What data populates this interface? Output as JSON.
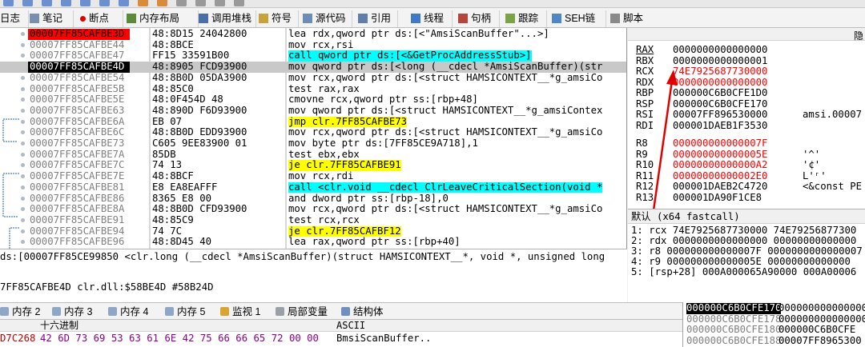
{
  "colors": {
    "highlight_yellow": "#ffff00",
    "highlight_cyan": "#00ffff",
    "breakpoint_red": "#ff0000",
    "rip_black": "#000000",
    "changed_register_red": "#ff0000",
    "arrow_red": "#e00000",
    "jump_line_blue": "#1f5fbf"
  },
  "tabs": [
    {
      "label": "日志",
      "icon": "log-icon"
    },
    {
      "label": "笔记",
      "icon": "notes-icon"
    },
    {
      "label": "断点",
      "icon": "breakpoint-icon"
    },
    {
      "label": "内存布局",
      "icon": "memory-map-icon"
    },
    {
      "label": "调用堆栈",
      "icon": "callstack-icon"
    },
    {
      "label": "符号",
      "icon": "symbols-icon"
    },
    {
      "label": "源代码",
      "icon": "source-icon"
    },
    {
      "label": "引用",
      "icon": "references-icon"
    },
    {
      "label": "线程",
      "icon": "threads-icon"
    },
    {
      "label": "句柄",
      "icon": "handles-icon"
    },
    {
      "label": "跟踪",
      "icon": "trace-icon"
    },
    {
      "label": "SEH链",
      "icon": "seh-icon"
    },
    {
      "label": "脚本",
      "icon": "script-icon"
    }
  ],
  "disasm": [
    {
      "addr": "00007FF85CAFBE3D",
      "bytes": "48:8D15 24042800",
      "instr": "lea rdx,qword ptr ds:[<\"AmsiScanBuffer\"...>]",
      "mark": "bp"
    },
    {
      "addr": "00007FF85CAFBE44",
      "bytes": "48:8BCE",
      "instr": "mov rcx,rsi"
    },
    {
      "addr": "00007FF85CAFBE47",
      "bytes": "FF15 33591B00",
      "instr": "call qword ptr ds:[<&GetProcAddressStub>]",
      "hl": "call"
    },
    {
      "addr": "00007FF85CAFBE4D",
      "bytes": "48:8905 FCD93900",
      "instr": "mov qword ptr ds:[<long (__cdecl *AmsiScanBuffer)(str",
      "mark": "rip"
    },
    {
      "addr": "00007FF85CAFBE54",
      "bytes": "48:8B0D 05DA3900",
      "instr": "mov rcx,qword ptr ds:[<struct HAMSICONTEXT__*g_amsiCo"
    },
    {
      "addr": "00007FF85CAFBE5B",
      "bytes": "48:85C0",
      "instr": "test rax,rax"
    },
    {
      "addr": "00007FF85CAFBE5E",
      "bytes": "48:0F454D 48",
      "instr": "cmovne rcx,qword ptr ss:[rbp+48]"
    },
    {
      "addr": "00007FF85CAFBE63",
      "bytes": "48:890D F6D93900",
      "instr": "mov qword ptr ds:[<struct HAMSICONTEXT__*g_amsiContex"
    },
    {
      "addr": "00007FF85CAFBE6A",
      "bytes": "EB 07",
      "instr": "jmp clr.7FF85CAFBE73",
      "hl": "jmp"
    },
    {
      "addr": "00007FF85CAFBE6C",
      "bytes": "48:8B0D EDD93900",
      "instr": "mov rcx,qword ptr ds:[<struct HAMSICONTEXT__*g_amsiCo"
    },
    {
      "addr": "00007FF85CAFBE73",
      "bytes": "C605 9EE83900 01",
      "instr": "mov byte ptr ds:[7FF85CE9A718],1"
    },
    {
      "addr": "00007FF85CAFBE7A",
      "bytes": "85DB",
      "instr": "test ebx,ebx"
    },
    {
      "addr": "00007FF85CAFBE7C",
      "bytes": "74 13",
      "instr": "je clr.7FF85CAFBE91",
      "hl": "jmp"
    },
    {
      "addr": "00007FF85CAFBE7E",
      "bytes": "48:8BCF",
      "instr": "mov rcx,rdi"
    },
    {
      "addr": "00007FF85CAFBE81",
      "bytes": "E8 EA8EAFFF",
      "instr": "call <clr.void __cdecl ClrLeaveCriticalSection(void *",
      "hl": "call"
    },
    {
      "addr": "00007FF85CAFBE86",
      "bytes": "8365 E8 00",
      "instr": "and dword ptr ss:[rbp-18],0"
    },
    {
      "addr": "00007FF85CAFBE8A",
      "bytes": "48:8B0D CFD93900",
      "instr": "mov rcx,qword ptr ds:[<struct HAMSICONTEXT__*g_amsiCo"
    },
    {
      "addr": "00007FF85CAFBE91",
      "bytes": "48:85C9",
      "instr": "test rcx,rcx"
    },
    {
      "addr": "00007FF85CAFBE94",
      "bytes": "74 7C",
      "instr": "je clr.7FF85CAFBF12",
      "hl": "jmp"
    },
    {
      "addr": "00007FF85CAFBE96",
      "bytes": "48:8D45 40",
      "instr": "lea rax,qword ptr ss:[rbp+40]"
    }
  ],
  "info": {
    "line1": "ds:[00007FF85CE99850 <clr.long (__cdecl *AmsiScanBuffer)(struct HAMSICONTEXT__*, void *, unsigned long",
    "line2": "7FF85CAFBE4D clr.dll:$58BE4D #58B24D"
  },
  "registers_header": "隐",
  "registers": [
    {
      "name": "RAX",
      "value": "0000000000000000",
      "comment": "",
      "changed": false,
      "underline": true
    },
    {
      "name": "RBX",
      "value": "0000000000000001",
      "comment": "",
      "changed": false
    },
    {
      "name": "RCX",
      "value": "74E7925687730000",
      "comment": "",
      "changed": true
    },
    {
      "name": "RDX",
      "value": "0000000000000000",
      "comment": "",
      "changed": true
    },
    {
      "name": "RBP",
      "value": "000000C6B0CFE1D0",
      "comment": "",
      "changed": false
    },
    {
      "name": "RSP",
      "value": "000000C6B0CFE170",
      "comment": "",
      "changed": false
    },
    {
      "name": "RSI",
      "value": "00007FF896530000",
      "comment": "amsi.00007",
      "changed": false
    },
    {
      "name": "RDI",
      "value": "000001DAEB1F3530",
      "comment": "",
      "changed": false
    },
    {
      "name": "R8",
      "value": "000000000000007F",
      "comment": "",
      "changed": true
    },
    {
      "name": "R9",
      "value": "000000000000005E",
      "comment": "'^'",
      "changed": true
    },
    {
      "name": "R10",
      "value": "00000000000000A2",
      "comment": "'¢'",
      "changed": true
    },
    {
      "name": "R11",
      "value": "00000000000002E0",
      "comment": "L'ʳ'",
      "changed": true
    },
    {
      "name": "R12",
      "value": "000001DAEB2C4720",
      "comment": "<&const PE",
      "changed": false
    },
    {
      "name": "R13",
      "value": "000001DA90F1CE8",
      "comment": "",
      "changed": false
    }
  ],
  "callconv": {
    "title": "默认 (x64 fastcall)",
    "rows": [
      "1: rcx 74E7925687730000 74E79256877300",
      "2: rdx 0000000000000000 00000000000000",
      "3: r8 000000000000007F 0000000000000007",
      "4: r9 000000000000005E 00000000000000",
      "5: [rsp+28] 000A000065A90000 000A00006"
    ]
  },
  "dump_tabs": [
    {
      "label": "内存 2",
      "icon": "memory-icon"
    },
    {
      "label": "内存 3",
      "icon": "memory-icon"
    },
    {
      "label": "内存 4",
      "icon": "memory-icon"
    },
    {
      "label": "内存 5",
      "icon": "memory-icon"
    },
    {
      "label": "监视 1",
      "icon": "watch-icon"
    },
    {
      "label": "局部变量",
      "icon": "locals-icon"
    },
    {
      "label": "结构体",
      "icon": "struct-icon"
    }
  ],
  "dump": {
    "hex_header": "十六进制",
    "ascii_header": "ASCII",
    "row_addr": "D7C268",
    "row_hex": "42 6D 73 69 53 63 61 6E 42 75 66 66 65 72 00 00",
    "row_ascii": "BmsiScanBuffer.."
  },
  "stack": [
    {
      "addr": "000000C6B0CFE170",
      "value": "000000000000000",
      "top": true
    },
    {
      "addr": "000000C6B0CFE178",
      "value": "000000000000000"
    },
    {
      "addr": "000000C6B0CFE180",
      "value": "000000C6B0CFE"
    },
    {
      "addr": "000000C6B0CFE188",
      "value": "00007FF8965300"
    }
  ]
}
